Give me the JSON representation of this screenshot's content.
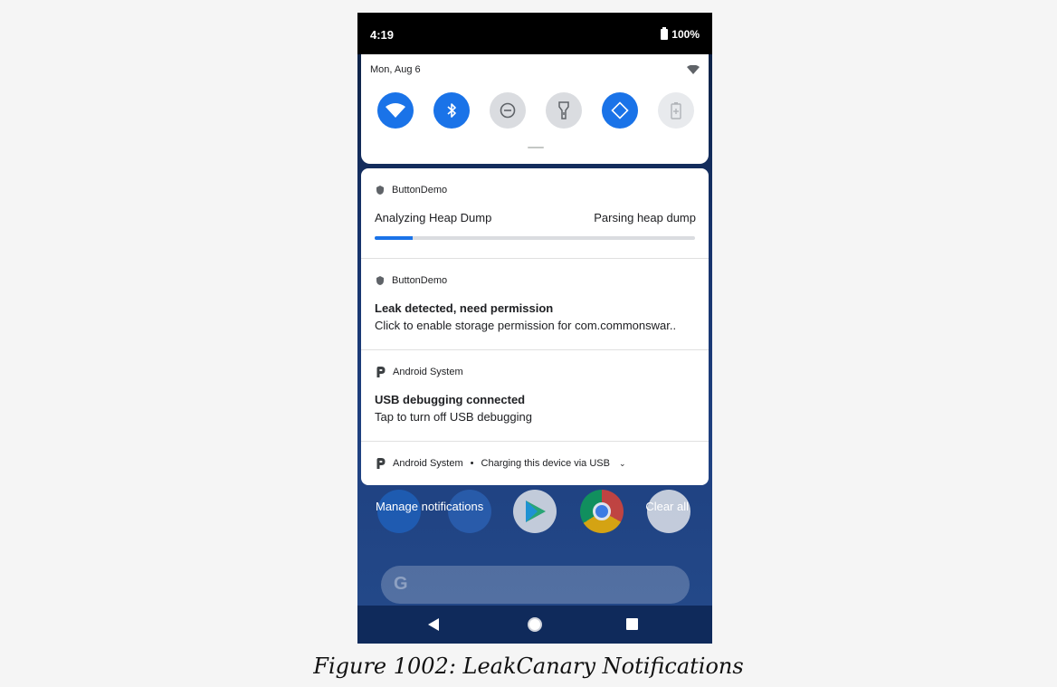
{
  "status_bar": {
    "time": "4:19",
    "battery": "100%"
  },
  "quick_settings": {
    "date": "Mon, Aug 6",
    "tiles": [
      {
        "name": "wifi-icon",
        "state": "on"
      },
      {
        "name": "bluetooth-icon",
        "state": "on"
      },
      {
        "name": "do-not-disturb-icon",
        "state": "off"
      },
      {
        "name": "flashlight-icon",
        "state": "off"
      },
      {
        "name": "auto-rotate-icon",
        "state": "on"
      },
      {
        "name": "battery-saver-icon",
        "state": "disabled"
      }
    ]
  },
  "notifications": [
    {
      "app": "ButtonDemo",
      "title": "Analyzing Heap Dump",
      "right_text": "Parsing heap dump",
      "progress_percent": 12
    },
    {
      "app": "ButtonDemo",
      "title": "Leak detected, need permission",
      "body": "Click to enable storage permission for com.commonswar.."
    },
    {
      "app": "Android System",
      "title": "USB debugging connected",
      "body": "Tap to turn off USB debugging"
    },
    {
      "app": "Android System",
      "separator": "•",
      "summary": "Charging this device via USB"
    }
  ],
  "actions": {
    "manage": "Manage notifications",
    "clear": "Clear all"
  },
  "search": {
    "logo": "G"
  },
  "caption": "Figure 1002: LeakCanary Notifications",
  "colors": {
    "accent": "#1a73e8",
    "wallpaper": "#1f4181"
  }
}
